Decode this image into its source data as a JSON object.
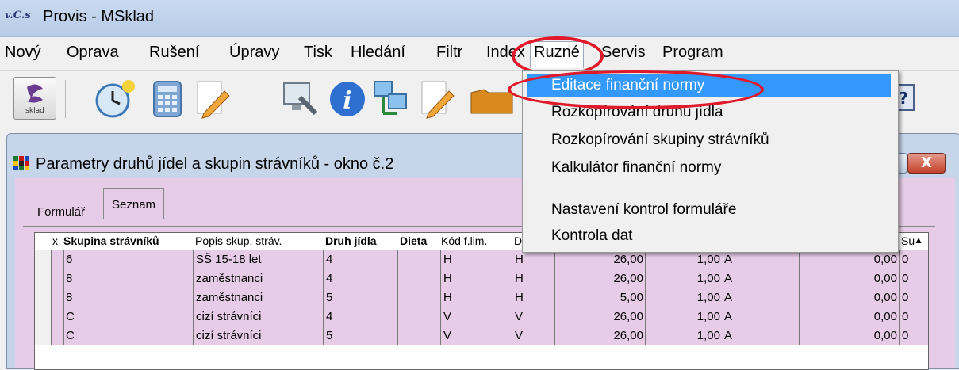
{
  "app": {
    "logo_text": "v.C.s",
    "title": "Provis - MSklad"
  },
  "menu": [
    "Nový",
    "Oprava",
    "Rušení",
    "Úpravy",
    "Tisk",
    "Hledání",
    "Filtr",
    "Index",
    "Ruzné",
    "Servis",
    "Program"
  ],
  "toolbar": {
    "sklad_label": "sklad"
  },
  "dropdown": {
    "items": [
      {
        "label": "Editace finanční normy",
        "highlighted": true
      },
      {
        "label": "Rozkopírování druhu jídla"
      },
      {
        "label": "Rozkopírování skupiny strávníků"
      },
      {
        "label": "Kalkulátor finanční normy"
      },
      {
        "label": "Nastavení kontrol formuláře"
      },
      {
        "label": "Kontrola dat"
      }
    ]
  },
  "window": {
    "title": "Parametry druhů jídel a skupin strávníků - okno č.2",
    "close": "X"
  },
  "tabs": {
    "form": "Formulář",
    "list": "Seznam"
  },
  "grid": {
    "headers": [
      "x",
      "Skupina strávníků",
      "Popis skup. stráv.",
      "Druh jídla",
      "Dieta",
      "Kód f.lim.",
      "D",
      "Su"
    ],
    "rows": [
      [
        "6",
        "SŠ 15-18 let",
        "4",
        "",
        "H",
        "H",
        "26,00",
        "1,00",
        "A",
        "0,00",
        "0"
      ],
      [
        "8",
        "zaměstnanci",
        "4",
        "",
        "H",
        "H",
        "26,00",
        "1,00",
        "A",
        "0,00",
        "0"
      ],
      [
        "8",
        "zaměstnanci",
        "5",
        "",
        "H",
        "H",
        "5,00",
        "1,00",
        "A",
        "0,00",
        "0"
      ],
      [
        "C",
        "cizí strávníci",
        "4",
        "",
        "V",
        "V",
        "26,00",
        "1,00",
        "A",
        "0,00",
        "0"
      ],
      [
        "C",
        "cizí strávníci",
        "5",
        "",
        "V",
        "V",
        "26,00",
        "1,00",
        "A",
        "0,00",
        "0"
      ]
    ]
  },
  "colors": {
    "highlight": "#3399ff",
    "annotation": "#e0192b",
    "grid_bg": "#e6cce7"
  }
}
